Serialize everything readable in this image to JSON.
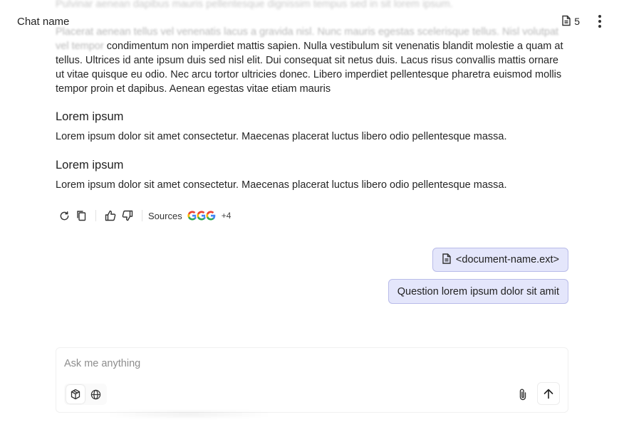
{
  "header": {
    "chat_name": "Chat name",
    "doc_count": "5"
  },
  "faded_line": "Pulvinar aenean dapibus mauris pellentesque dignissim tempus sed in sit lorem ipsum.",
  "message": {
    "para_blur": "Placerat aenean tellus vel venenatis lacus a gravida nisl. Nunc mauris egestas scelerisque tellus. Nisl volutpat vel tempor",
    "para_text": "condimentum non imperdiet mattis sapien. Nulla vestibulum sit venenatis blandit molestie a quam at tellus. Ultrices id ante ipsum duis sed nisl elit. Dui consequat sit netus duis. Lacus risus convallis mattis ornare ut vitae quisque eu odio. Nec arcu tortor ultricies donec. Libero imperdiet pellentesque pharetra euismod mollis tempor proin et dapibus. Aenean egestas vitae etiam mauris",
    "sections": [
      {
        "heading": "Lorem ipsum",
        "body": "Lorem ipsum dolor sit amet consectetur. Maecenas placerat luctus libero odio pellentesque massa."
      },
      {
        "heading": "Lorem ipsum",
        "body": "Lorem ipsum dolor sit amet consectetur. Maecenas placerat luctus libero odio pellentesque massa."
      }
    ],
    "actions": {
      "sources_label": "Sources",
      "more_sources": "+4"
    }
  },
  "user": {
    "document": "<document-name.ext>",
    "question": "Question lorem ipsum dolor sit amit"
  },
  "composer": {
    "placeholder": "Ask me anything"
  },
  "icons": {
    "header": [
      "document-icon",
      "more-vertical-icon"
    ],
    "actions": [
      "regenerate-icon",
      "copy-icon",
      "thumbs-up-icon",
      "thumbs-down-icon",
      "google-icon"
    ],
    "composer": [
      "cube-icon",
      "globe-icon",
      "paperclip-icon",
      "arrow-up-icon"
    ]
  },
  "colors": {
    "pill_bg": "#e4e6fb",
    "pill_border": "#b9bce9",
    "google_blue": "#4285F4",
    "google_red": "#EA4335",
    "google_yellow": "#FBBC05",
    "google_green": "#34A853"
  }
}
